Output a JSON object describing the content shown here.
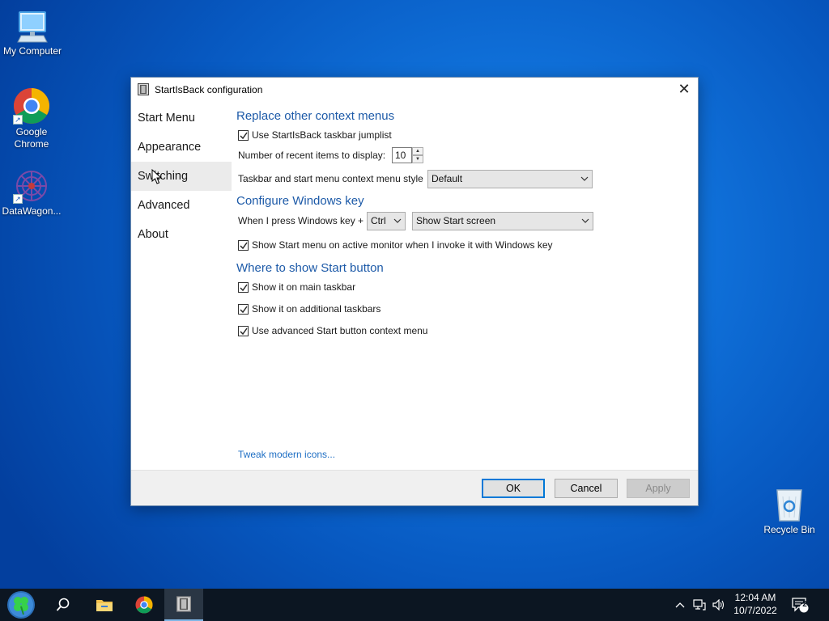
{
  "desktop": {
    "icons": [
      {
        "label": "My Computer",
        "icon": "computer-icon"
      },
      {
        "label": "Google Chrome",
        "icon": "chrome-icon"
      },
      {
        "label": "DataWagon...",
        "icon": "datawagon-icon"
      },
      {
        "label": "Recycle Bin",
        "icon": "recycle-bin-icon"
      }
    ]
  },
  "dialog": {
    "title": "StartIsBack configuration",
    "close_symbol": "✕",
    "nav": [
      "Start Menu",
      "Appearance",
      "Switching",
      "Advanced",
      "About"
    ],
    "active_nav": "Switching",
    "sections": {
      "context_menus": {
        "title": "Replace other context menus",
        "use_jumplist_label": "Use StartIsBack taskbar jumplist",
        "use_jumplist_checked": true,
        "recent_items_label": "Number of recent items to display:",
        "recent_items_value": "10",
        "menu_style_label": "Taskbar and start menu context menu style",
        "menu_style_value": "Default"
      },
      "windows_key": {
        "title": "Configure Windows key",
        "press_label": "When I press Windows key +",
        "modifier_value": "Ctrl",
        "action_value": "Show Start screen",
        "active_monitor_label": "Show Start menu on active monitor when I invoke it with Windows key",
        "active_monitor_checked": true
      },
      "start_button": {
        "title": "Where to show Start button",
        "main_taskbar_label": "Show it on main taskbar",
        "main_taskbar_checked": true,
        "additional_label": "Show it on additional taskbars",
        "additional_checked": true,
        "advanced_menu_label": "Use advanced Start button context menu",
        "advanced_menu_checked": true
      }
    },
    "tweak_link": "Tweak modern icons...",
    "buttons": {
      "ok": "OK",
      "cancel": "Cancel",
      "apply": "Apply"
    }
  },
  "taskbar": {
    "items": [
      "start-button",
      "search-icon",
      "file-explorer-icon",
      "chrome-icon",
      "startisback-config-icon"
    ],
    "active_item": "startisback-config-icon",
    "time": "12:04 AM",
    "date": "10/7/2022",
    "notification_count": "2"
  },
  "colors": {
    "accent": "#0078d7",
    "section_title": "#1d5aa8",
    "link": "#1f6fc4",
    "taskbar": "#0c1622"
  }
}
